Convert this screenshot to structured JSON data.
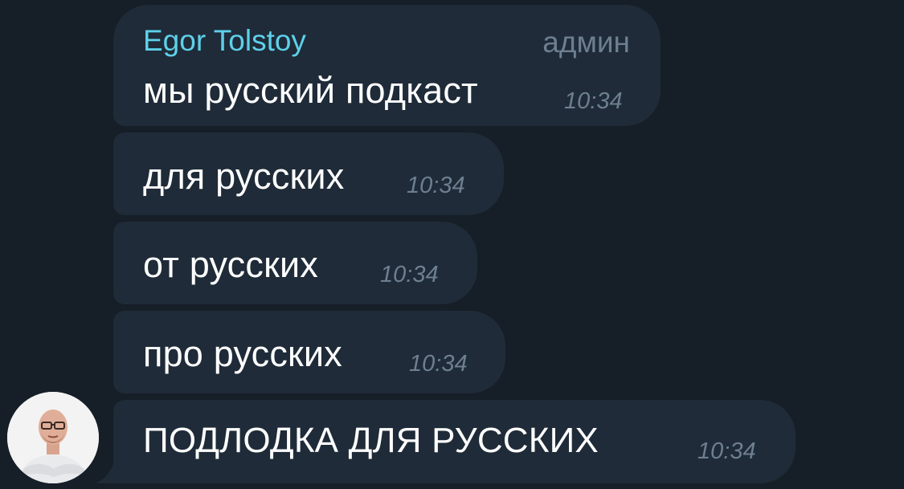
{
  "chat": {
    "sender_name": "Egor Tolstoy",
    "sender_role": "админ",
    "messages": [
      {
        "text": "мы русский подкаст",
        "time": "10:34"
      },
      {
        "text": "для русских",
        "time": "10:34"
      },
      {
        "text": "от русских",
        "time": "10:34"
      },
      {
        "text": "про русских",
        "time": "10:34"
      },
      {
        "text": "ПОДЛОДКА ДЛЯ РУССКИХ",
        "time": "10:34"
      }
    ]
  },
  "colors": {
    "background": "#161e27",
    "bubble": "#1f2b38",
    "sender_name": "#5ed0ea",
    "timestamp": "#6d7f90",
    "text": "#ffffff"
  },
  "icons": {
    "avatar": "user-avatar-photo"
  }
}
